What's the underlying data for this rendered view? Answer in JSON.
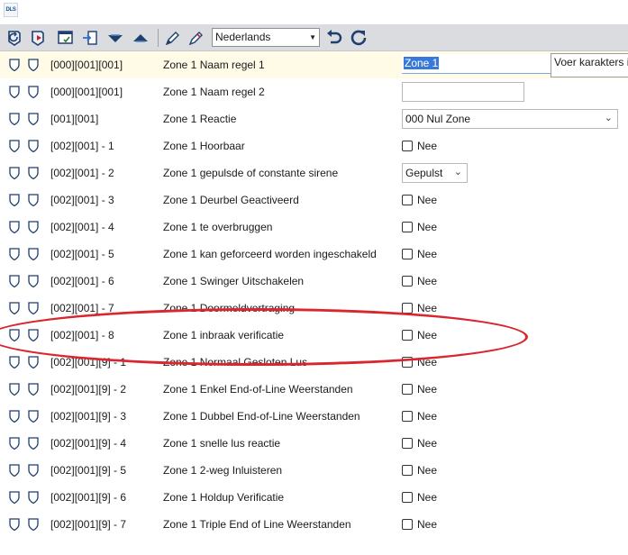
{
  "app": {
    "logo_text": "DLS"
  },
  "toolbar": {
    "language_select": {
      "value": "Nederlands"
    },
    "buttons": [
      {
        "icon": "shield-refresh-icon"
      },
      {
        "icon": "shield-arrow-icon"
      },
      {
        "icon": "window-check-icon"
      },
      {
        "icon": "import-arrow-icon"
      },
      {
        "icon": "arrow-down-icon"
      },
      {
        "icon": "arrow-up-icon"
      },
      {
        "icon": "pencil-icon"
      },
      {
        "icon": "pencil-alt-icon"
      },
      {
        "icon": "undo-icon"
      },
      {
        "icon": "refresh-icon"
      }
    ]
  },
  "rows": [
    {
      "code": "[000][001][001]",
      "name": "Zone 1 Naam regel 1",
      "control": "text",
      "value": "Zone 1",
      "active": true,
      "hint": "Voer karakters in"
    },
    {
      "code": "[000][001][001]",
      "name": "Zone 1 Naam regel 2",
      "control": "text",
      "value": ""
    },
    {
      "code": "[001][001]",
      "name": "Zone 1 Reactie",
      "control": "select",
      "value": "000 Nul Zone"
    },
    {
      "code": "[002][001] - 1",
      "name": "Zone 1 Hoorbaar",
      "control": "checkbox",
      "value": "Nee"
    },
    {
      "code": "[002][001] - 2",
      "name": "Zone 1 gepulsde of constante sirene",
      "control": "select-small",
      "value": "Gepulst"
    },
    {
      "code": "[002][001] - 3",
      "name": "Zone 1 Deurbel Geactiveerd",
      "control": "checkbox",
      "value": "Nee"
    },
    {
      "code": "[002][001] - 4",
      "name": "Zone 1 te overbruggen",
      "control": "checkbox",
      "value": "Nee"
    },
    {
      "code": "[002][001] - 5",
      "name": "Zone 1 kan geforceerd worden ingeschakeld",
      "control": "checkbox",
      "value": "Nee"
    },
    {
      "code": "[002][001] - 6",
      "name": "Zone 1 Swinger Uitschakelen",
      "control": "checkbox",
      "value": "Nee"
    },
    {
      "code": "[002][001] - 7",
      "name": "Zone 1 Doormeldvertraging",
      "control": "checkbox",
      "value": "Nee"
    },
    {
      "code": "[002][001] - 8",
      "name": "Zone 1 inbraak verificatie",
      "control": "checkbox",
      "value": "Nee"
    },
    {
      "code": "[002][001][9] - 1",
      "name": "Zone 1 Normaal Gesloten Lus",
      "control": "checkbox",
      "value": "Nee"
    },
    {
      "code": "[002][001][9] - 2",
      "name": "Zone 1 Enkel End-of-Line Weerstanden",
      "control": "checkbox",
      "value": "Nee"
    },
    {
      "code": "[002][001][9] - 3",
      "name": "Zone 1 Dubbel End-of-Line Weerstanden",
      "control": "checkbox",
      "value": "Nee"
    },
    {
      "code": "[002][001][9] - 4",
      "name": "Zone 1 snelle lus reactie",
      "control": "checkbox",
      "value": "Nee"
    },
    {
      "code": "[002][001][9] - 5",
      "name": "Zone 1 2-weg Inluisteren",
      "control": "checkbox",
      "value": "Nee"
    },
    {
      "code": "[002][001][9] - 6",
      "name": "Zone 1 Holdup Verificatie",
      "control": "checkbox",
      "value": "Nee"
    },
    {
      "code": "[002][001][9] - 7",
      "name": "Zone 1 Triple End of Line Weerstanden",
      "control": "checkbox",
      "value": "Nee"
    }
  ],
  "annotation": {
    "color": "#d9262f",
    "shape": "ellipse",
    "highlighted_row": "[002][001] - 8"
  }
}
